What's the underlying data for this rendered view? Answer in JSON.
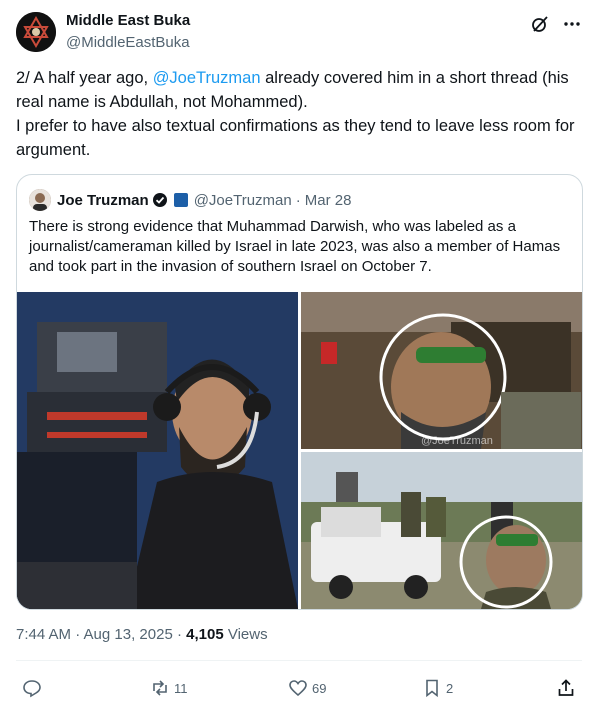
{
  "author": {
    "name": "Middle East Buka",
    "handle": "@MiddleEastBuka"
  },
  "tweet": {
    "part1": "2/ A half year ago, ",
    "mention": "@JoeTruzman",
    "part2": " already covered him in a short thread (his real name is Abdullah, not Mohammed).",
    "line2": "I prefer to have also textual confirmations as they tend to leave less room for argument."
  },
  "quote": {
    "name": "Joe Truzman",
    "handle": "@JoeTruzman",
    "sep": "·",
    "date": "Mar 28",
    "text": "There is strong evidence that Muhammad Darwish, who was labeled as a journalist/cameraman killed by Israel in late 2023, was also a member of Hamas and took part in the invasion of southern Israel on October  7.",
    "watermark": "@JoeTruzman"
  },
  "meta": {
    "time": "7:44 AM · Aug 13, 2025 · ",
    "views_count": "4,105",
    "views_label": " Views"
  },
  "actions": {
    "retweets": "11",
    "likes": "69",
    "bookmarks": "2"
  },
  "colors": {
    "accent": "#1d9bf0",
    "text": "#0f1419",
    "secondary": "#536471",
    "border": "#cfd9de"
  }
}
